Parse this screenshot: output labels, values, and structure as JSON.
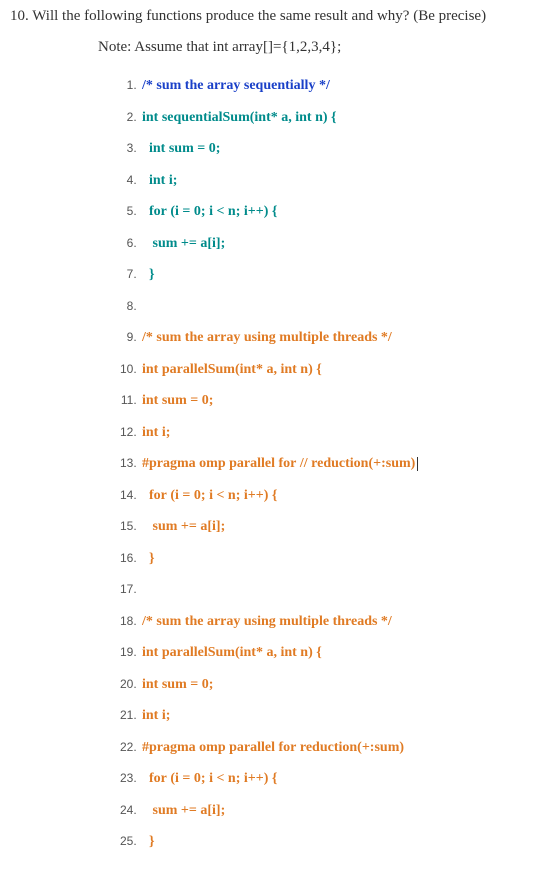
{
  "question_text": "10. Will the following functions produce the same result and why? (Be precise)",
  "note_text": "Note: Assume that int array[]={1,2,3,4};",
  "lines": [
    {
      "text": "/* sum the array sequentially */",
      "color": "blue"
    },
    {
      "text": "int sequentialSum(int* a, int n) {",
      "color": "teal"
    },
    {
      "text": "  int sum = 0;",
      "color": "teal"
    },
    {
      "text": "  int i;",
      "color": "teal"
    },
    {
      "text": "  for (i = 0; i < n; i++) {",
      "color": "teal"
    },
    {
      "text": "   sum += a[i];",
      "color": "teal"
    },
    {
      "text": "  }",
      "color": "teal"
    },
    {
      "text": " ",
      "color": "teal"
    },
    {
      "text": "/* sum the array using multiple threads */",
      "color": "orange"
    },
    {
      "text": "int parallelSum(int* a, int n) {",
      "color": "orange"
    },
    {
      "text": "int sum = 0;",
      "color": "orange"
    },
    {
      "text": "int i;",
      "color": "orange"
    },
    {
      "text": "#pragma omp parallel for // reduction(+:sum)",
      "color": "orange",
      "caret": true
    },
    {
      "text": "  for (i = 0; i < n; i++) {",
      "color": "orange"
    },
    {
      "text": "   sum += a[i];",
      "color": "orange"
    },
    {
      "text": "  }",
      "color": "orange"
    },
    {
      "text": " ",
      "color": "orange"
    },
    {
      "text": "/* sum the array using multiple threads */",
      "color": "orange"
    },
    {
      "text": "int parallelSum(int* a, int n) {",
      "color": "orange"
    },
    {
      "text": "int sum = 0;",
      "color": "orange"
    },
    {
      "text": "int i;",
      "color": "orange"
    },
    {
      "text": "#pragma omp parallel for reduction(+:sum)",
      "color": "orange"
    },
    {
      "text": "  for (i = 0; i < n; i++) {",
      "color": "orange"
    },
    {
      "text": "   sum += a[i];",
      "color": "orange"
    },
    {
      "text": "  }",
      "color": "orange"
    }
  ]
}
